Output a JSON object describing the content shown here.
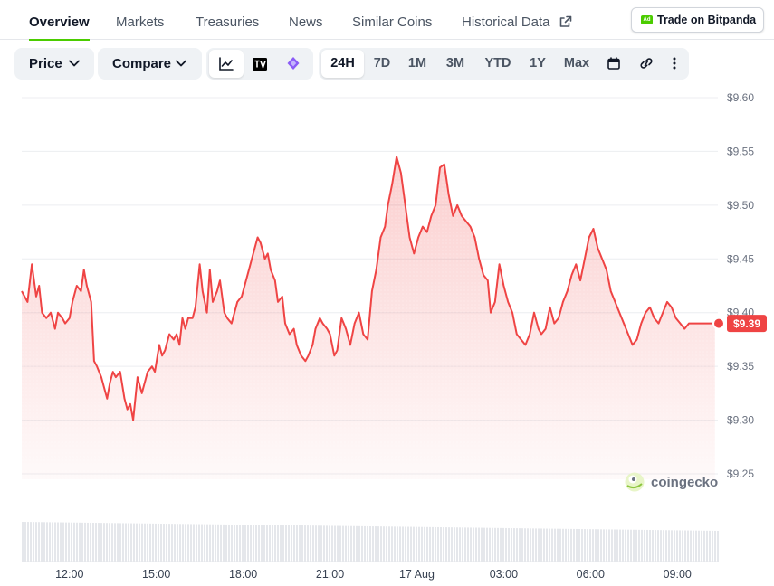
{
  "tabs": [
    {
      "label": "Overview",
      "active": true
    },
    {
      "label": "Markets",
      "active": false
    },
    {
      "label": "Treasuries",
      "active": false
    },
    {
      "label": "News",
      "active": false
    },
    {
      "label": "Similar Coins",
      "active": false
    },
    {
      "label": "Historical Data",
      "active": false,
      "external": true
    }
  ],
  "trade_button": {
    "badge": "Ad",
    "label": "Trade on Bitpanda"
  },
  "toolbar": {
    "price_label": "Price",
    "compare_label": "Compare",
    "ranges": [
      "24H",
      "7D",
      "1M",
      "3M",
      "YTD",
      "1Y",
      "Max"
    ],
    "selected_range": "24H"
  },
  "icons": {
    "chart_types": [
      "line-chart-icon",
      "tradingview-icon",
      "diamond-icon"
    ],
    "tools": [
      "calendar-icon",
      "link-icon",
      "more-vertical-icon"
    ]
  },
  "watermark": "coingecko",
  "colors": {
    "line": "#ef4444",
    "accent_green": "#4bcc00",
    "price_tag": "#ef4444"
  },
  "chart_data": {
    "type": "area",
    "title": "",
    "xlabel": "",
    "ylabel": "",
    "x_ticks": [
      "12:00",
      "15:00",
      "18:00",
      "21:00",
      "17 Aug",
      "03:00",
      "06:00",
      "09:00"
    ],
    "x_hours": [
      12,
      15,
      18,
      21,
      24,
      27,
      30,
      33
    ],
    "x_range_hours": [
      10.35,
      34.4
    ],
    "y_ticks": [
      "$9.60",
      "$9.55",
      "$9.50",
      "$9.45",
      "$9.40",
      "$9.35",
      "$9.30",
      "$9.25"
    ],
    "y_tick_values": [
      9.6,
      9.55,
      9.5,
      9.45,
      9.4,
      9.35,
      9.3,
      9.25
    ],
    "ylim": [
      9.245,
      9.6
    ],
    "grid": true,
    "current_price_label": "$9.39",
    "current_price": 9.39,
    "series": [
      {
        "x": [
          10.35,
          10.55,
          10.7,
          10.85,
          10.95,
          11.05,
          11.2,
          11.35,
          11.5,
          11.6,
          11.75,
          11.85,
          12.0,
          12.1,
          12.25,
          12.4,
          12.5,
          12.6,
          12.75,
          12.85,
          12.95,
          13.1,
          13.2,
          13.3,
          13.4,
          13.5,
          13.6,
          13.75,
          13.9,
          14.0,
          14.1,
          14.2,
          14.35,
          14.5,
          14.6,
          14.7,
          14.85,
          14.95,
          15.1,
          15.2,
          15.3,
          15.45,
          15.6,
          15.7,
          15.8,
          15.9,
          16.0,
          16.1,
          16.25,
          16.35,
          16.5,
          16.6,
          16.75,
          16.85,
          16.95,
          17.1,
          17.2,
          17.35,
          17.45,
          17.6,
          17.7,
          17.8,
          17.95,
          18.05,
          18.2,
          18.3,
          18.4,
          18.5,
          18.6,
          18.75,
          18.85,
          18.95,
          19.1,
          19.2,
          19.35,
          19.45,
          19.6,
          19.75,
          19.85,
          20.0,
          20.15,
          20.25,
          20.4,
          20.5,
          20.65,
          20.75,
          20.9,
          21.0,
          21.15,
          21.25,
          21.4,
          21.55,
          21.7,
          21.85,
          22.0,
          22.15,
          22.3,
          22.45,
          22.6,
          22.75,
          22.9,
          23.0,
          23.15,
          23.3,
          23.45,
          23.6,
          23.75,
          23.9,
          24.05,
          24.2,
          24.35,
          24.5,
          24.65,
          24.8,
          24.95,
          25.1,
          25.25,
          25.4,
          25.55,
          25.7,
          25.85,
          26.0,
          26.15,
          26.3,
          26.45,
          26.55,
          26.7,
          26.85,
          27.0,
          27.15,
          27.3,
          27.45,
          27.6,
          27.75,
          27.9,
          28.05,
          28.2,
          28.3,
          28.45,
          28.6,
          28.75,
          28.9,
          29.05,
          29.2,
          29.35,
          29.5,
          29.65,
          29.8,
          29.95,
          30.1,
          30.25,
          30.4,
          30.55,
          30.7,
          30.85,
          31.0,
          31.15,
          31.3,
          31.45,
          31.6,
          31.75,
          31.9,
          32.05,
          32.2,
          32.35,
          32.5,
          32.65,
          32.8,
          32.95,
          33.1,
          33.25,
          33.4,
          33.55,
          33.7,
          33.85,
          34.0,
          34.15,
          34.3
        ],
        "y": [
          9.42,
          9.41,
          9.445,
          9.415,
          9.425,
          9.4,
          9.395,
          9.4,
          9.385,
          9.4,
          9.395,
          9.39,
          9.395,
          9.41,
          9.425,
          9.42,
          9.44,
          9.425,
          9.41,
          9.355,
          9.35,
          9.34,
          9.33,
          9.32,
          9.335,
          9.345,
          9.34,
          9.345,
          9.32,
          9.31,
          9.315,
          9.3,
          9.34,
          9.325,
          9.335,
          9.345,
          9.35,
          9.345,
          9.37,
          9.36,
          9.365,
          9.38,
          9.375,
          9.38,
          9.37,
          9.395,
          9.385,
          9.395,
          9.395,
          9.405,
          9.445,
          9.42,
          9.4,
          9.44,
          9.41,
          9.42,
          9.43,
          9.4,
          9.395,
          9.39,
          9.4,
          9.41,
          9.415,
          9.425,
          9.44,
          9.45,
          9.46,
          9.47,
          9.465,
          9.45,
          9.455,
          9.44,
          9.43,
          9.41,
          9.415,
          9.39,
          9.38,
          9.385,
          9.37,
          9.36,
          9.355,
          9.36,
          9.37,
          9.385,
          9.395,
          9.39,
          9.385,
          9.38,
          9.36,
          9.365,
          9.395,
          9.385,
          9.37,
          9.39,
          9.4,
          9.38,
          9.375,
          9.42,
          9.44,
          9.47,
          9.48,
          9.5,
          9.52,
          9.545,
          9.53,
          9.5,
          9.47,
          9.455,
          9.47,
          9.48,
          9.475,
          9.49,
          9.5,
          9.535,
          9.538,
          9.51,
          9.49,
          9.5,
          9.49,
          9.485,
          9.48,
          9.47,
          9.45,
          9.435,
          9.43,
          9.4,
          9.41,
          9.445,
          9.425,
          9.41,
          9.4,
          9.38,
          9.375,
          9.37,
          9.38,
          9.4,
          9.385,
          9.38,
          9.385,
          9.405,
          9.39,
          9.395,
          9.41,
          9.42,
          9.435,
          9.445,
          9.43,
          9.45,
          9.47,
          9.478,
          9.46,
          9.45,
          9.44,
          9.42,
          9.41,
          9.4,
          9.39,
          9.38,
          9.37,
          9.375,
          9.39,
          9.4,
          9.405,
          9.395,
          9.39,
          9.4,
          9.41,
          9.405,
          9.395,
          9.39,
          9.385,
          9.39,
          9.39,
          9.39,
          9.39,
          9.39,
          9.39,
          9.39
        ]
      }
    ]
  }
}
